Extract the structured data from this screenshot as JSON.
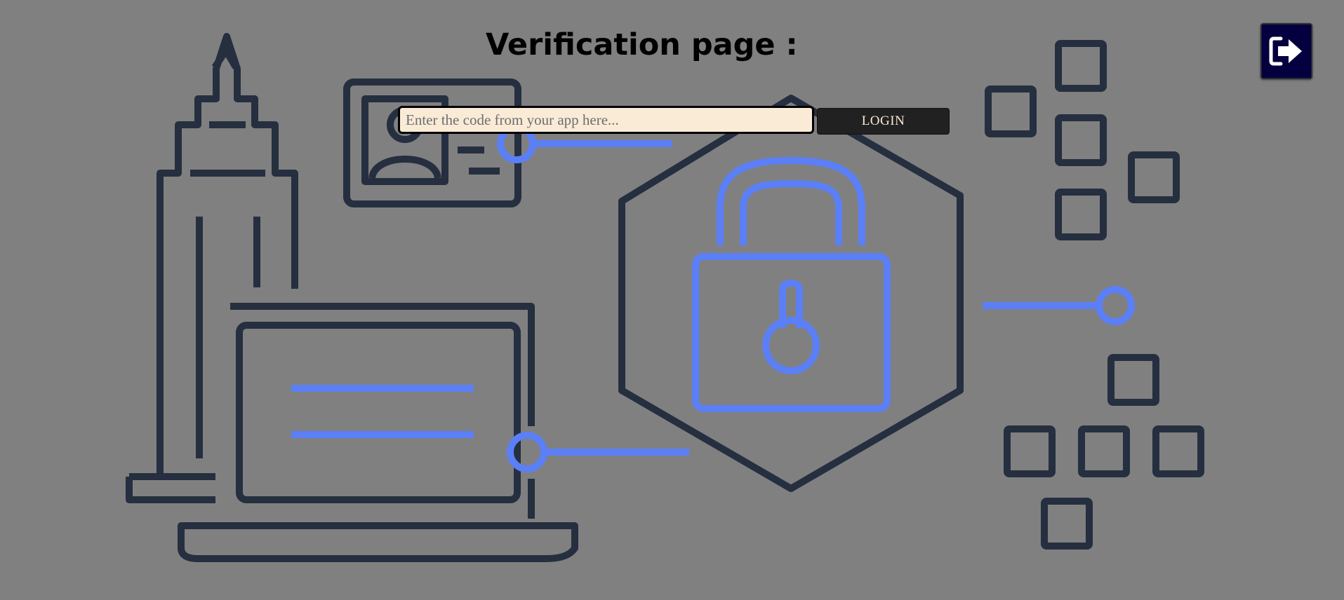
{
  "page": {
    "title": "Verification page :"
  },
  "verification_form": {
    "code_input_value": "",
    "code_input_placeholder": "Enter the code from your app here...",
    "login_label": "LOGIN"
  },
  "logout": {
    "icon": "sign-out-icon"
  },
  "colors": {
    "background": "#808080",
    "illustration_dark": "#252f40",
    "illustration_accent": "#5b7ff7",
    "input_background": "#faebd7",
    "button_background": "#212121",
    "button_text": "#faebd7",
    "logout_background": "#04003f"
  },
  "illustration_icons": [
    "skyscraper-icon",
    "id-card-icon",
    "laptop-icon",
    "padlock-hexagon-icon",
    "square-grid-icon",
    "connector-node-icon"
  ]
}
